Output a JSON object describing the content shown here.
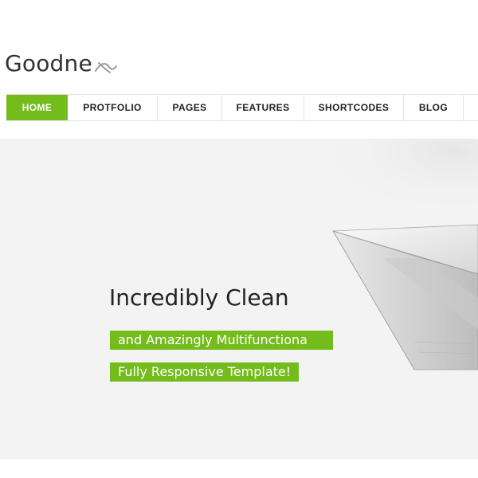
{
  "brand": {
    "name_text": "Goodne",
    "name_mark": "x"
  },
  "nav": {
    "items": [
      {
        "label": "HOME",
        "active": true
      },
      {
        "label": "PROTFOLIO",
        "active": false
      },
      {
        "label": "PAGES",
        "active": false
      },
      {
        "label": "FEATURES",
        "active": false
      },
      {
        "label": "SHORTCODES",
        "active": false
      },
      {
        "label": "BLOG",
        "active": false
      }
    ]
  },
  "hero": {
    "headline": "Incredibly Clean",
    "tagline_1": "and Amazingly Multifunctiona",
    "tagline_2": "Fully Responsive Template!",
    "image": "paper-plane"
  },
  "colors": {
    "accent": "#74bc1c",
    "text": "#222222",
    "hero_bg": "#f3f3f3"
  }
}
